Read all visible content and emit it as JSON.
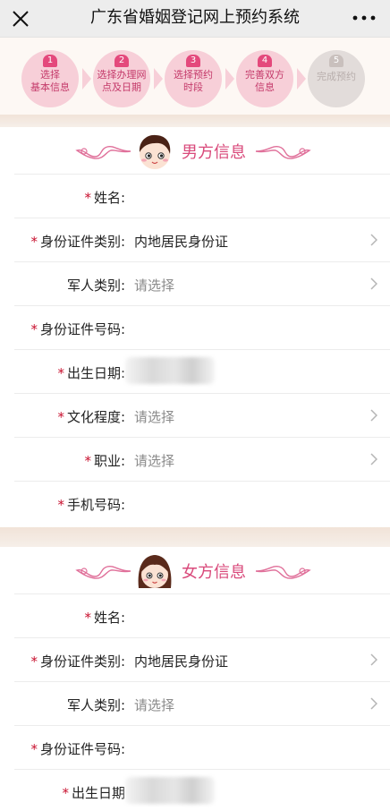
{
  "header": {
    "title": "广东省婚姻登记网上预约系统",
    "close_icon": "close-icon",
    "more_icon": "more-dots-icon"
  },
  "steps": [
    {
      "num": "1",
      "line1": "选择",
      "line2": "基本信息",
      "active": true
    },
    {
      "num": "2",
      "line1": "选择办理网",
      "line2": "点及日期",
      "active": true
    },
    {
      "num": "3",
      "line1": "选择预约",
      "line2": "时段",
      "active": true
    },
    {
      "num": "4",
      "line1": "完善双方",
      "line2": "信息",
      "active": true
    },
    {
      "num": "5",
      "line1": "完成预约",
      "line2": "",
      "active": false
    }
  ],
  "male": {
    "title": "男方信息",
    "rows": [
      {
        "label": "姓名:",
        "required": true,
        "value": ""
      },
      {
        "label": "身份证件类别:",
        "required": true,
        "value": "内地居民身份证",
        "chevron": true
      },
      {
        "label": "军人类别:",
        "required": false,
        "placeholder": "请选择",
        "chevron": true
      },
      {
        "label": "身份证件号码:",
        "required": true,
        "value": ""
      },
      {
        "label": "出生日期:",
        "required": true,
        "value": "",
        "blurred": true
      },
      {
        "label": "文化程度:",
        "required": true,
        "placeholder": "请选择",
        "chevron": true
      },
      {
        "label": "职业:",
        "required": true,
        "placeholder": "请选择",
        "chevron": true
      },
      {
        "label": "手机号码:",
        "required": true,
        "value": ""
      }
    ]
  },
  "female": {
    "title": "女方信息",
    "rows": [
      {
        "label": "姓名:",
        "required": true,
        "value": ""
      },
      {
        "label": "身份证件类别:",
        "required": true,
        "value": "内地居民身份证",
        "chevron": true
      },
      {
        "label": "军人类别:",
        "required": false,
        "placeholder": "请选择",
        "chevron": true
      },
      {
        "label": "身份证件号码:",
        "required": true,
        "value": ""
      },
      {
        "label": "出生日期",
        "required": true,
        "value": "",
        "blurred": true
      }
    ]
  },
  "colors": {
    "accent": "#d94a7b",
    "step_bg": "#f7cfd8",
    "step_disabled": "#e2dcda",
    "required": "#c8102e",
    "placeholder": "#8a8a8a"
  }
}
